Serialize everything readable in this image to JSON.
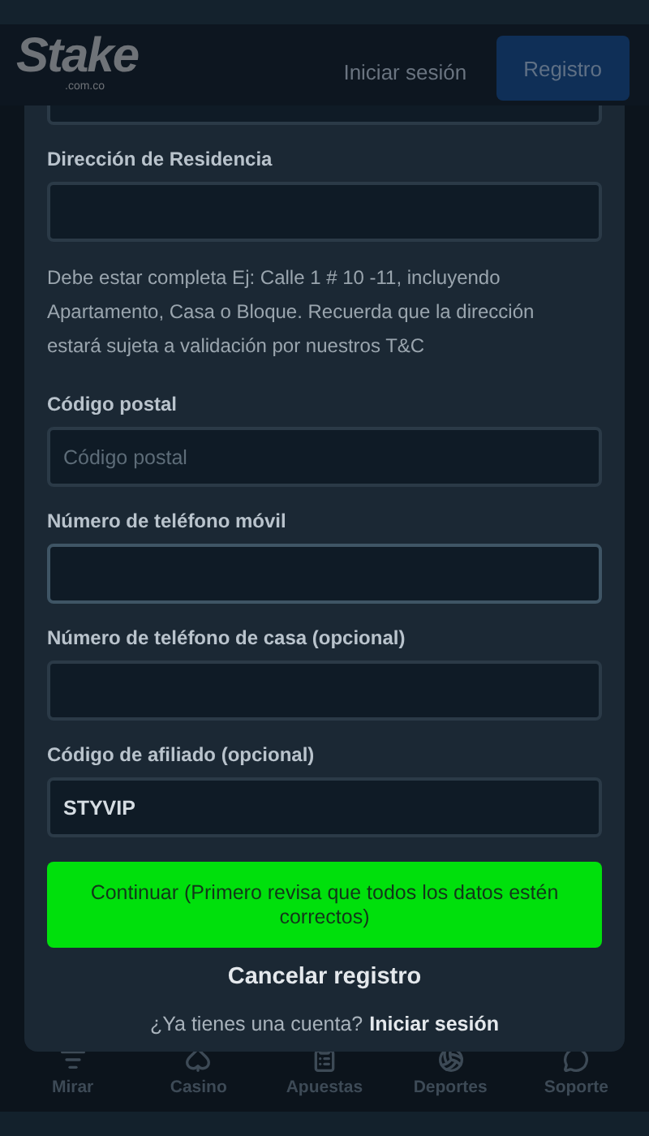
{
  "header": {
    "logo": "Stake",
    "logo_sub": ".com.co",
    "login": "Iniciar sesión",
    "register": "Registro"
  },
  "form": {
    "fields": [
      {
        "kind": "textarea",
        "label": "Dirección de Residencia",
        "focused": false,
        "help": "Debe estar completa Ej: Calle 1 # 10 -11, incluyendo Apartamento, Casa o Bloque. Recuerda que la dirección estará sujeta a validación por nuestros T&C"
      },
      {
        "kind": "text",
        "label": "Código postal",
        "placeholder": "Código postal",
        "focused": false
      },
      {
        "kind": "text",
        "label": "Número de teléfono móvil",
        "focused": true
      },
      {
        "kind": "text",
        "label": "Número de teléfono de casa (opcional)",
        "focused": false
      },
      {
        "kind": "text",
        "label": "Código de afiliado (opcional)",
        "value": "STYVIP",
        "focused": false
      }
    ],
    "submit": "Continuar (Primero revisa que todos los datos estén correctos)",
    "cancel": "Cancelar registro",
    "footer_text": "¿Ya tienes una cuenta?",
    "footer_link": "Iniciar sesión"
  },
  "bottom_nav": [
    {
      "label": "Mirar"
    },
    {
      "label": "Casino"
    },
    {
      "label": "Apuestas"
    },
    {
      "label": "Deportes"
    },
    {
      "label": "Soporte"
    }
  ]
}
